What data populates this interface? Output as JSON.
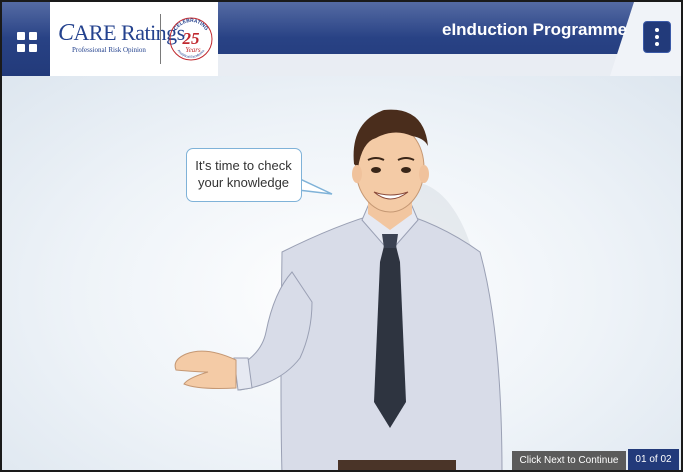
{
  "header": {
    "title": "eInduction Programme",
    "logo": {
      "brand": "ARE Ratings",
      "tagline": "Professional Risk Opinion",
      "seal_top": "CELEBRATING",
      "seal_number": "25",
      "seal_word": "Years",
      "seal_bottom": "Analytical Excellence"
    }
  },
  "icons": {
    "menu": "grid-icon",
    "more": "vertical-dots-icon"
  },
  "slide": {
    "speech": [
      "It's time to check",
      "your knowledge"
    ]
  },
  "footer": {
    "hint": "Click Next to Continue",
    "counter": "01 of 02"
  },
  "colors": {
    "header_blue": "#2f4a8f",
    "bubble_border": "#7fb2d8",
    "footer_gray": "#5b5b5b",
    "counter_blue": "#223a7a"
  }
}
